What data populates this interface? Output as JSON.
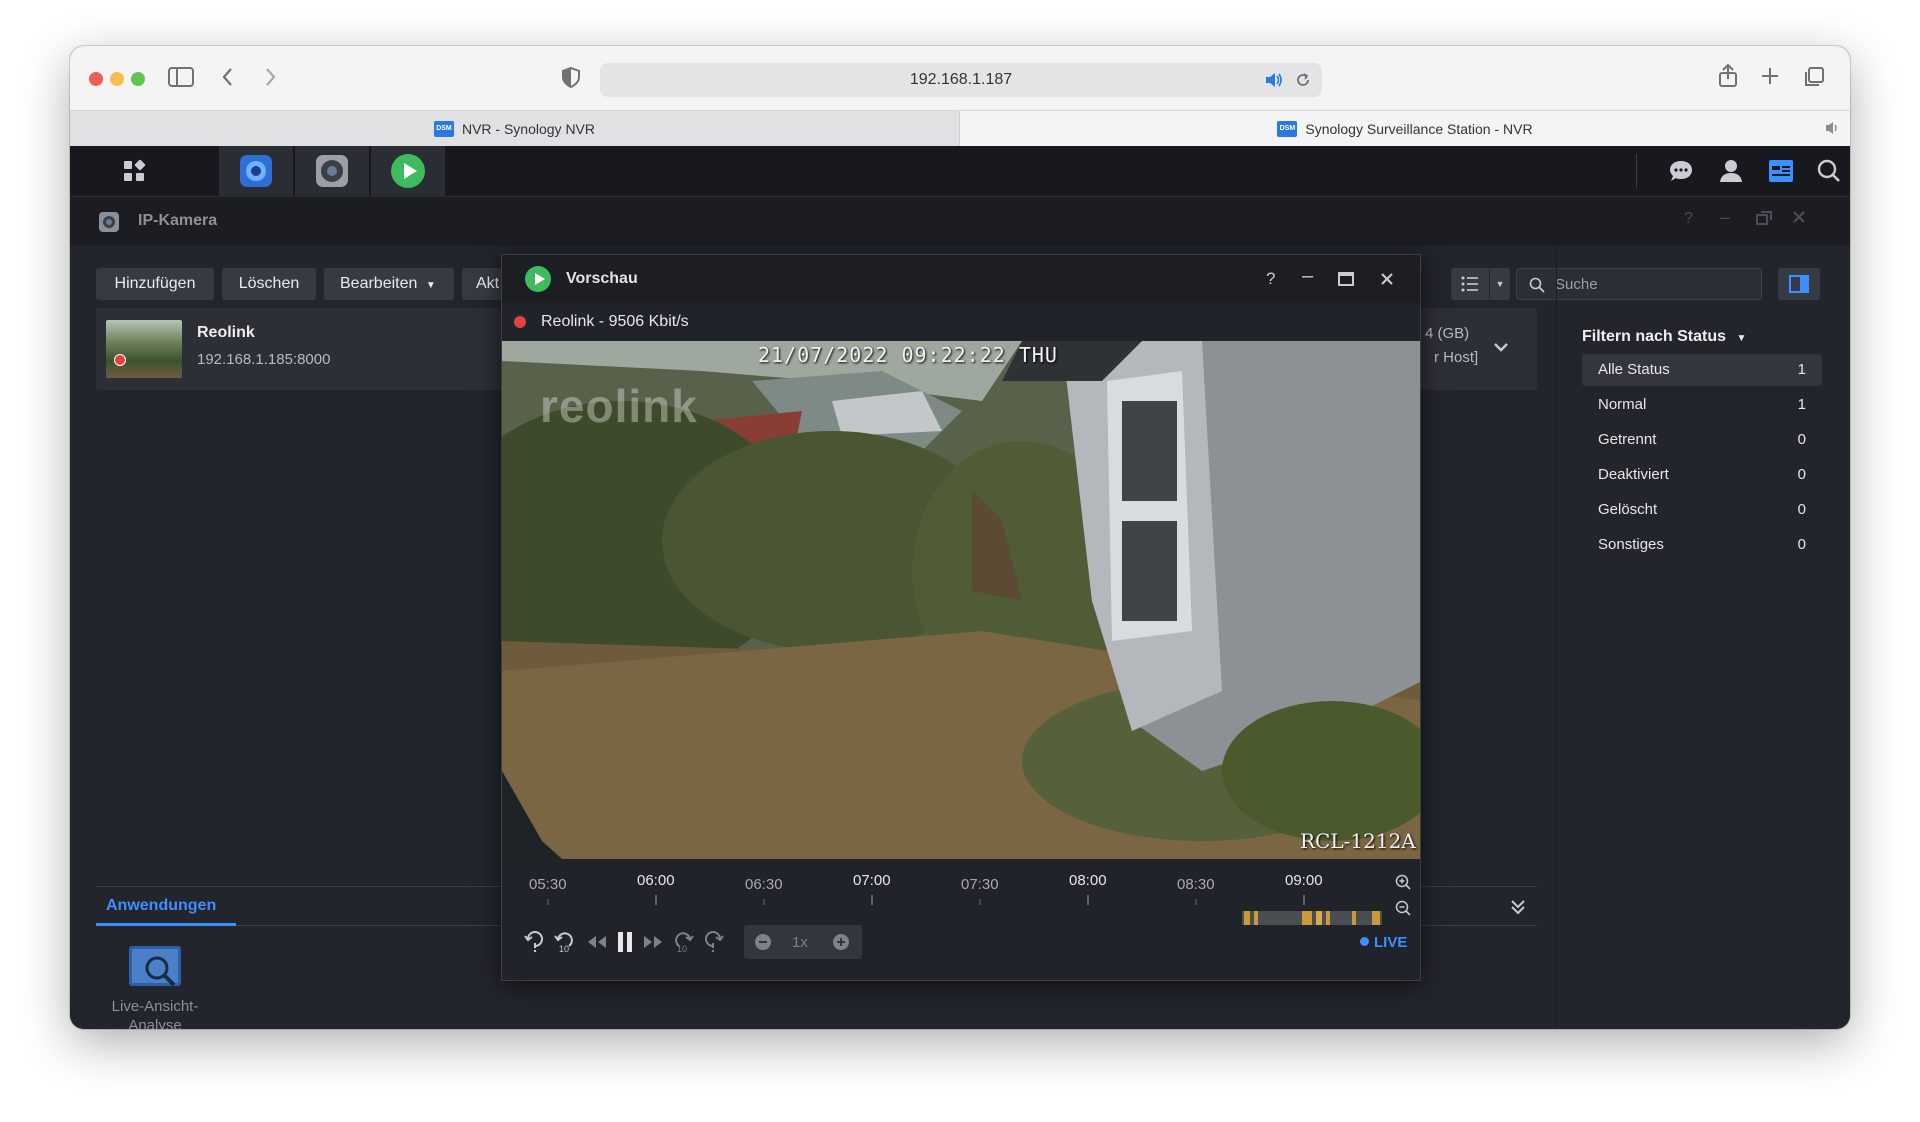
{
  "browser": {
    "url": "192.168.1.187",
    "tabs": [
      {
        "label": "NVR - Synology NVR",
        "badge": "DSM"
      },
      {
        "label": "Synology Surveillance Station - NVR",
        "badge": "DSM"
      }
    ]
  },
  "app": {
    "title": "IP-Kamera",
    "toolbar": {
      "add": "Hinzufügen",
      "delete": "Löschen",
      "edit": "Bearbeiten",
      "action": "Akt"
    },
    "search_placeholder": "Suche",
    "camera": {
      "name": "Reolink",
      "address": "192.168.1.185:8000",
      "storage": "4 (GB)",
      "host": "r Host]"
    },
    "filter": {
      "title": "Filtern nach Status",
      "items": [
        {
          "label": "Alle Status",
          "count": "1"
        },
        {
          "label": "Normal",
          "count": "1"
        },
        {
          "label": "Getrennt",
          "count": "0"
        },
        {
          "label": "Deaktiviert",
          "count": "0"
        },
        {
          "label": "Gelöscht",
          "count": "0"
        },
        {
          "label": "Sonstiges",
          "count": "0"
        }
      ]
    },
    "applications": {
      "tab": "Anwendungen",
      "items": [
        {
          "label": "Live-Ansicht-Analyse"
        }
      ]
    }
  },
  "preview": {
    "title": "Vorschau",
    "stream": "Reolink - 9506 Kbit/s",
    "overlay_datetime": "21/07/2022 09:22:22 THU",
    "overlay_model": "RCL-1212A",
    "watermark": "reolink",
    "timeline": [
      "05:30",
      "06:00",
      "06:30",
      "07:00",
      "07:30",
      "08:00",
      "08:30",
      "09:00"
    ],
    "speed": "1x",
    "live": "LIVE"
  },
  "colors": {
    "accent": "#3d8fff",
    "play_green": "#3dbb5e",
    "record_red": "#e2423f"
  }
}
